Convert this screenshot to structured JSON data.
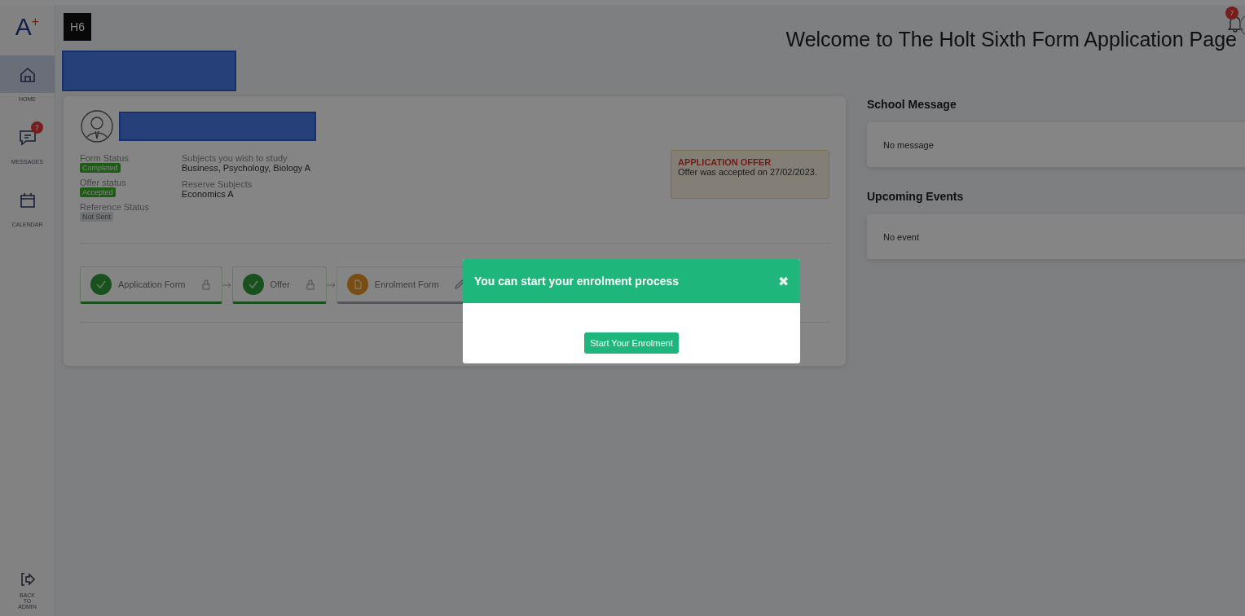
{
  "sidebar": {
    "logo": "A$^{+}$",
    "items": [
      {
        "label": "HOME",
        "selected": true
      },
      {
        "label": "MESSAGES",
        "selected": false,
        "badge": "7"
      },
      {
        "label": "CALENDAR",
        "selected": false
      }
    ],
    "footer_item": {
      "label": "BACK TO ADMIN"
    }
  },
  "header": {
    "school_logo": "H6",
    "title": "Welcome to The Holt Sixth Form Application Page",
    "notification_badge": "7"
  },
  "profile": {
    "statuses": [
      {
        "label": "Form Status",
        "value": "Completed",
        "kind": "success"
      },
      {
        "label": "Offer status",
        "value": "Accepted",
        "kind": "success"
      },
      {
        "label": "Reference Status",
        "value": "Not Sent",
        "kind": "neutral"
      }
    ],
    "subjects": [
      {
        "label": "Subjects you wish to study",
        "value": "Business, Psychology, Biology A"
      },
      {
        "label": "Reserve Subjects",
        "value": "Economics A"
      }
    ],
    "offer_notice": {
      "title": "APPLICATION OFFER",
      "text": "Offer was accepted on 27/02/2023."
    },
    "steps": [
      {
        "label": "Application Form",
        "kind": "done"
      },
      {
        "label": "Offer",
        "kind": "done"
      },
      {
        "label": "Enrolment Form",
        "kind": "current"
      }
    ]
  },
  "school_message": {
    "heading": "School Message",
    "text": "No message"
  },
  "upcoming_events": {
    "heading": "Upcoming Events",
    "text": "No event"
  },
  "modal": {
    "title": "You can start your enrolment process",
    "close": "✖",
    "button": "Start Your Enrolment"
  }
}
